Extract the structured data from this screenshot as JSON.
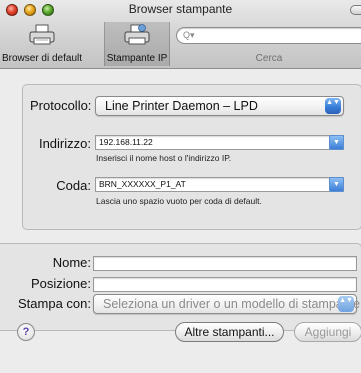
{
  "window": {
    "title": "Browser stampante"
  },
  "toolbar": {
    "default_label": "Browser di default",
    "ip_label": "Stampante IP",
    "search_placeholder": "",
    "search_label": "Cerca"
  },
  "form": {
    "protocol_label": "Protocollo:",
    "protocol_value": "Line Printer Daemon – LPD",
    "address_label": "Indirizzo:",
    "address_value": "192.168.11.22",
    "address_hint": "Inserisci il nome host o l'indirizzo IP.",
    "queue_label": "Coda:",
    "queue_value": "BRN_XXXXXX_P1_AT",
    "queue_hint": "Lascia uno spazio vuoto per coda di default."
  },
  "details": {
    "name_label": "Nome:",
    "name_value": "",
    "location_label": "Posizione:",
    "location_value": "",
    "print_using_label": "Stampa con:",
    "print_using_value": "Seleziona un driver o un modello di stampante"
  },
  "buttons": {
    "help": "?",
    "more_printers": "Altre stampanti...",
    "add": "Aggiungi"
  },
  "icons": {
    "popup_arrows": "▲▼",
    "combo_arrow": "▼",
    "search": "Q▾"
  }
}
